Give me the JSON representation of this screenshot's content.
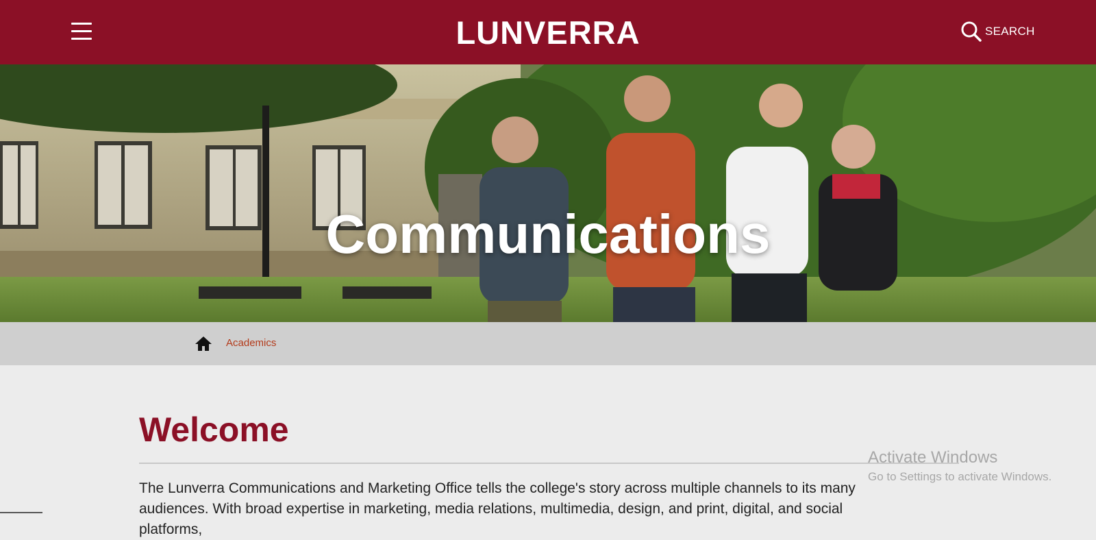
{
  "header": {
    "brand": "LUNVERRA",
    "search_label": "SEARCH",
    "menu_icon": "hamburger-menu-icon",
    "search_icon": "search-icon",
    "background_color": "#8b1026"
  },
  "hero": {
    "title": "Communications"
  },
  "breadcrumb": {
    "home_icon": "home-icon",
    "items": [
      {
        "label": "Academics"
      }
    ]
  },
  "main": {
    "heading": "Welcome",
    "intro": "The Lunverra Communications and Marketing Office tells the college's story across multiple channels to its many audiences. With broad expertise in marketing, media relations, multimedia, design, and print, digital, and social platforms,"
  },
  "watermark": {
    "title": "Activate Windows",
    "subtitle": "Go to Settings to activate Windows."
  },
  "colors": {
    "accent": "#8b1026",
    "link": "#b33a1a",
    "breadcrumb_bg": "#cfcfcf",
    "page_bg": "#ececec"
  }
}
